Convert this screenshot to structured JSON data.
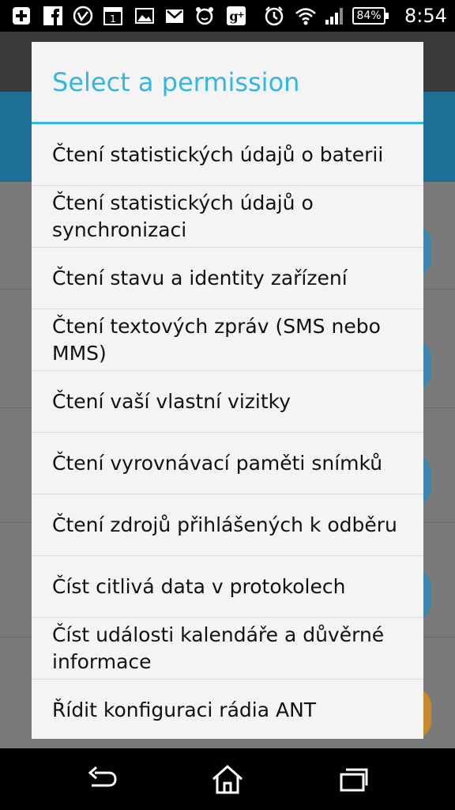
{
  "status_bar": {
    "icons": [
      "add-icon",
      "facebook-icon",
      "vine-icon",
      "calendar-icon",
      "gallery-icon",
      "gmail-icon",
      "alarm-clock-app-icon",
      "google-plus-icon",
      "alarm-icon",
      "wifi-icon",
      "signal-icon"
    ],
    "calendar_day": "1",
    "battery": "84%",
    "time": "8:54"
  },
  "dialog": {
    "title": "Select a permission",
    "accent_color": "#33b5e5",
    "items": [
      {
        "label": "Čtení statistických údajů o baterii"
      },
      {
        "label": "Čtení statistických údajů o synchronizaci"
      },
      {
        "label": "Čtení stavu a identity zařízení"
      },
      {
        "label": "Čtení textových zpráv (SMS nebo MMS)"
      },
      {
        "label": "Čtení vaší vlastní vizitky"
      },
      {
        "label": "Čtení vyrovnávací paměti snímků"
      },
      {
        "label": "Čtení zdrojů přihlášených k odběru"
      },
      {
        "label": "Číst citlivá data v protokolech"
      },
      {
        "label": "Číst události kalendáře a důvěrné informace"
      },
      {
        "label": "Řídit konfiguraci rádia ANT"
      }
    ]
  },
  "nav_bar": {
    "buttons": [
      "back-icon",
      "home-icon",
      "recent-apps-icon"
    ]
  }
}
